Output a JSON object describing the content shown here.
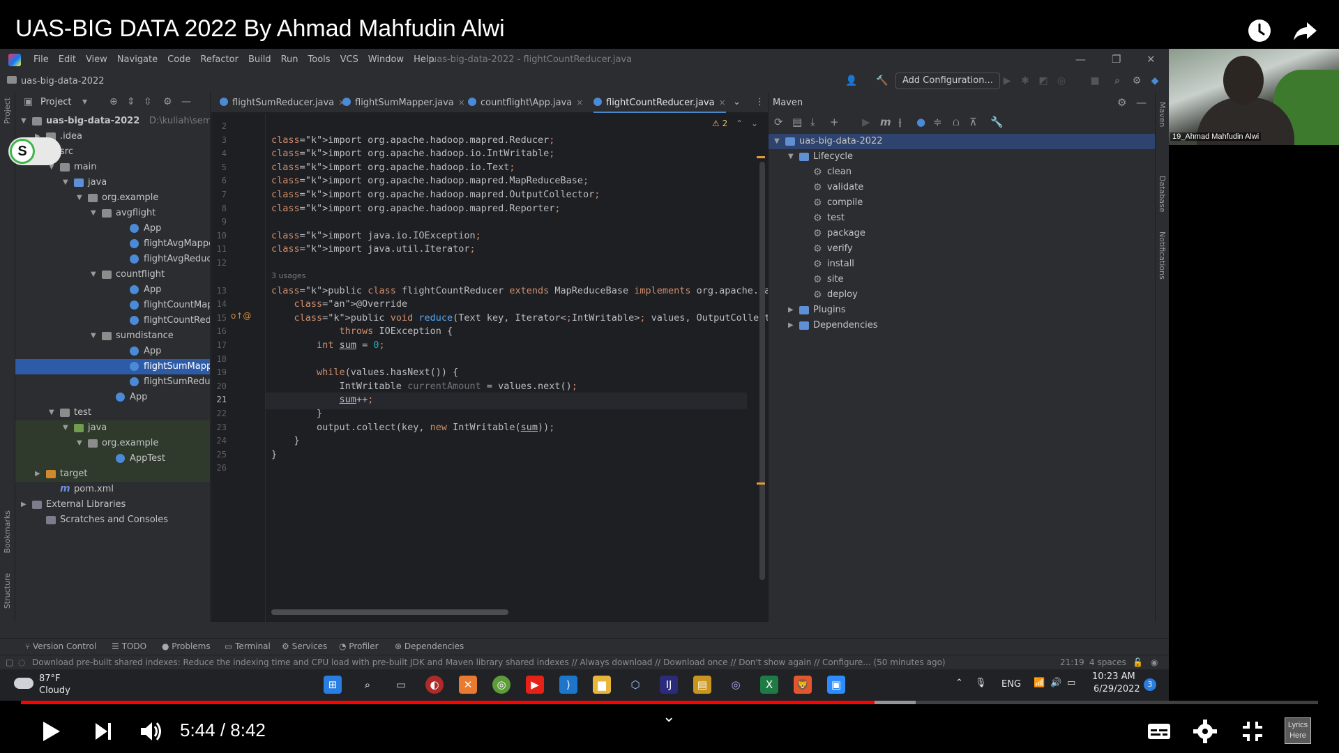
{
  "video": {
    "title": "UAS-BIG DATA 2022 By Ahmad Mahfudin Alwi",
    "time_current": "5:44",
    "time_separator": "/",
    "time_total": "8:42",
    "time_text": "5:44 / 8:42",
    "progress_fraction": 0.658,
    "buffer_fraction": 0.69,
    "lyrics_label": "Lyrics Here"
  },
  "ide": {
    "menu": [
      "File",
      "Edit",
      "View",
      "Navigate",
      "Code",
      "Refactor",
      "Build",
      "Run",
      "Tools",
      "VCS",
      "Window",
      "Help"
    ],
    "window_title": "uas-big-data-2022 - flightCountReducer.java",
    "project_breadcrumb": "uas-big-data-2022",
    "add_configuration": "Add Configuration...",
    "project_panel_title": "Project",
    "left_strip_project": "Project",
    "left_strip_bookmarks": "Bookmarks",
    "left_strip_structure": "Structure",
    "right_strip_maven": "Maven",
    "right_strip_database": "Database",
    "right_strip_notifications": "Notifications",
    "toggle_letter": "S",
    "tree": [
      {
        "label": "uas-big-data-2022",
        "extra": "D:\\kuliah\\semester",
        "icon": "folder",
        "depth": 0,
        "arrow": "down",
        "bold": true
      },
      {
        "label": ".idea",
        "icon": "folder",
        "depth": 1,
        "arrow": "right"
      },
      {
        "label": "src",
        "icon": "folder",
        "depth": 1,
        "arrow": "down"
      },
      {
        "label": "main",
        "icon": "folder",
        "depth": 2,
        "arrow": "down"
      },
      {
        "label": "java",
        "icon": "folder-blue",
        "depth": 3,
        "arrow": "down"
      },
      {
        "label": "org.example",
        "icon": "folder",
        "depth": 4,
        "arrow": "down"
      },
      {
        "label": "avgflight",
        "icon": "folder",
        "depth": 5,
        "arrow": "down"
      },
      {
        "label": "App",
        "icon": "class",
        "depth": 7
      },
      {
        "label": "flightAvgMapper",
        "icon": "class",
        "depth": 7
      },
      {
        "label": "flightAvgReducer",
        "icon": "class",
        "depth": 7
      },
      {
        "label": "countflight",
        "icon": "folder",
        "depth": 5,
        "arrow": "down"
      },
      {
        "label": "App",
        "icon": "class",
        "depth": 7
      },
      {
        "label": "flightCountMapper",
        "icon": "class",
        "depth": 7
      },
      {
        "label": "flightCountReducer",
        "icon": "class",
        "depth": 7
      },
      {
        "label": "sumdistance",
        "icon": "folder",
        "depth": 5,
        "arrow": "down"
      },
      {
        "label": "App",
        "icon": "class",
        "depth": 7
      },
      {
        "label": "flightSumMapper",
        "icon": "class",
        "depth": 7,
        "selected": true
      },
      {
        "label": "flightSumReducer",
        "icon": "class",
        "depth": 7
      },
      {
        "label": "App",
        "icon": "class",
        "depth": 6
      },
      {
        "label": "test",
        "icon": "folder",
        "depth": 2,
        "arrow": "down"
      },
      {
        "label": "java",
        "icon": "folder-green",
        "depth": 3,
        "arrow": "down",
        "green": true
      },
      {
        "label": "org.example",
        "icon": "folder",
        "depth": 4,
        "arrow": "down",
        "green": true
      },
      {
        "label": "AppTest",
        "icon": "class",
        "depth": 6,
        "green": true
      },
      {
        "label": "target",
        "icon": "folder-orange",
        "depth": 1,
        "arrow": "right",
        "green": true
      },
      {
        "label": "pom.xml",
        "icon": "m",
        "depth": 2
      },
      {
        "label": "External Libraries",
        "icon": "lib",
        "depth": 0,
        "arrow": "right"
      },
      {
        "label": "Scratches and Consoles",
        "icon": "lib",
        "depth": 1
      }
    ],
    "tabs": [
      {
        "label": "flightSumReducer.java",
        "active": false
      },
      {
        "label": "flightSumMapper.java",
        "active": false
      },
      {
        "label": "countflight\\App.java",
        "active": false
      },
      {
        "label": "flightCountReducer.java",
        "active": true
      }
    ],
    "tab_close": "×",
    "warning_count": "2",
    "usages_hint": "3 usages",
    "current_line": 21,
    "code_lines": [
      {
        "n": "2",
        "t": ""
      },
      {
        "n": "3",
        "t": "import org.apache.hadoop.mapred.Reducer;"
      },
      {
        "n": "4",
        "t": "import org.apache.hadoop.io.IntWritable;"
      },
      {
        "n": "5",
        "t": "import org.apache.hadoop.io.Text;"
      },
      {
        "n": "6",
        "t": "import org.apache.hadoop.mapred.MapReduceBase;"
      },
      {
        "n": "7",
        "t": "import org.apache.hadoop.mapred.OutputCollector;"
      },
      {
        "n": "8",
        "t": "import org.apache.hadoop.mapred.Reporter;"
      },
      {
        "n": "9",
        "t": ""
      },
      {
        "n": "10",
        "t": "import java.io.IOException;"
      },
      {
        "n": "11",
        "t": "import java.util.Iterator;"
      },
      {
        "n": "12",
        "t": ""
      },
      {
        "n": "13",
        "t": "public class flightCountReducer extends MapReduceBase implements org.apache.hadoo"
      },
      {
        "n": "14",
        "t": "    @Override"
      },
      {
        "n": "15",
        "t": "    public void reduce(Text key, Iterator<IntWritable> values, OutputCollector<Te"
      },
      {
        "n": "16",
        "t": "            throws IOException {"
      },
      {
        "n": "17",
        "t": "        int sum = 0;"
      },
      {
        "n": "18",
        "t": ""
      },
      {
        "n": "19",
        "t": "        while(values.hasNext()) {"
      },
      {
        "n": "20",
        "t": "            IntWritable currentAmount = values.next();"
      },
      {
        "n": "21",
        "t": "            sum++;"
      },
      {
        "n": "22",
        "t": "        }"
      },
      {
        "n": "23",
        "t": "        output.collect(key, new IntWritable(sum));"
      },
      {
        "n": "24",
        "t": "    }"
      },
      {
        "n": "25",
        "t": "}"
      },
      {
        "n": "26",
        "t": ""
      }
    ],
    "maven": {
      "title": "Maven",
      "root": "uas-big-data-2022",
      "lifecycle_label": "Lifecycle",
      "goals": [
        "clean",
        "validate",
        "compile",
        "test",
        "package",
        "verify",
        "install",
        "site",
        "deploy"
      ],
      "plugins_label": "Plugins",
      "dependencies_label": "Dependencies"
    },
    "tool_tabs": [
      "Version Control",
      "TODO",
      "Problems",
      "Terminal",
      "Services",
      "Profiler",
      "Dependencies"
    ],
    "status_message": "Download pre-built shared indexes: Reduce the indexing time and CPU load with pre-built JDK and Maven library shared indexes // Always download // Download once // Don't show again // Configure... (50 minutes ago)",
    "status_position": "21:19",
    "status_indent": "4 spaces"
  },
  "taskbar": {
    "temperature": "87°F",
    "weather": "Cloudy",
    "language": "ENG",
    "clock_time": "10:23 AM",
    "clock_date": "6/29/2022",
    "notification_count": "3"
  },
  "webcam": {
    "name": "19_Ahmad Mahfudin Alwi"
  }
}
